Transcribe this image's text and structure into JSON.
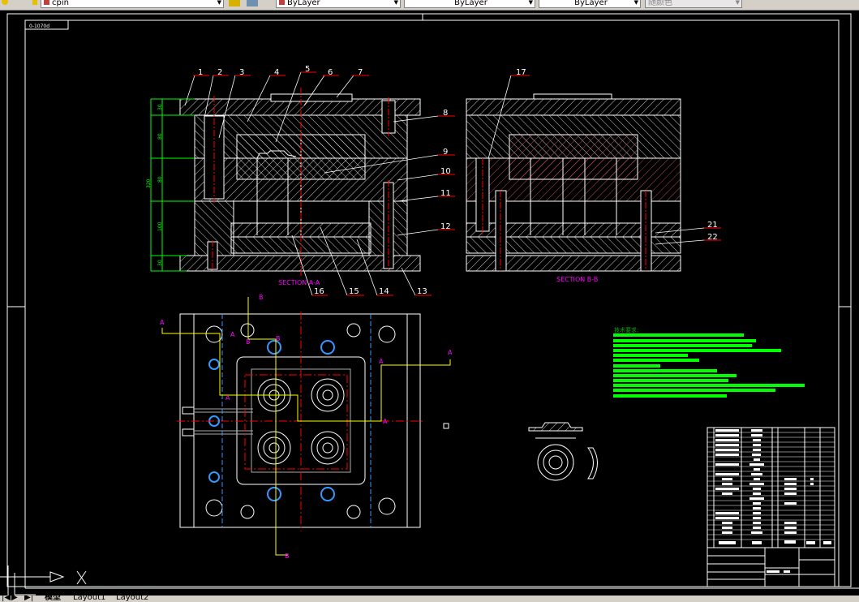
{
  "toolbar": {
    "layer_name": "cpin",
    "color": "ByLayer",
    "linetype": "ByLayer",
    "lineweight": "ByLayer",
    "plot_style": "随颜色"
  },
  "drawing": {
    "frame_label": "0-1070d",
    "section_aa": "SECTION A-A",
    "section_bb": "SECTION B-B",
    "part_numbers": [
      "1",
      "2",
      "3",
      "4",
      "5",
      "6",
      "7",
      "8",
      "9",
      "10",
      "11",
      "12",
      "13",
      "14",
      "15",
      "16",
      "17",
      "21",
      "22"
    ],
    "dimensions": [
      "30",
      "80",
      "80",
      "100",
      "30",
      "320"
    ],
    "section_markers": {
      "a": "A",
      "b": "B"
    },
    "tech_requirements_title": "技术要求:",
    "colors": {
      "background": "#000000",
      "outline": "#ffffff",
      "centerline": "#ff0000",
      "dimension": "#00ff00",
      "section_text": "#ff00ff",
      "cut_line": "#ffff00",
      "cooling": "#3399ff"
    }
  },
  "tabs": [
    "模型",
    "Layout1",
    "Layout2"
  ]
}
